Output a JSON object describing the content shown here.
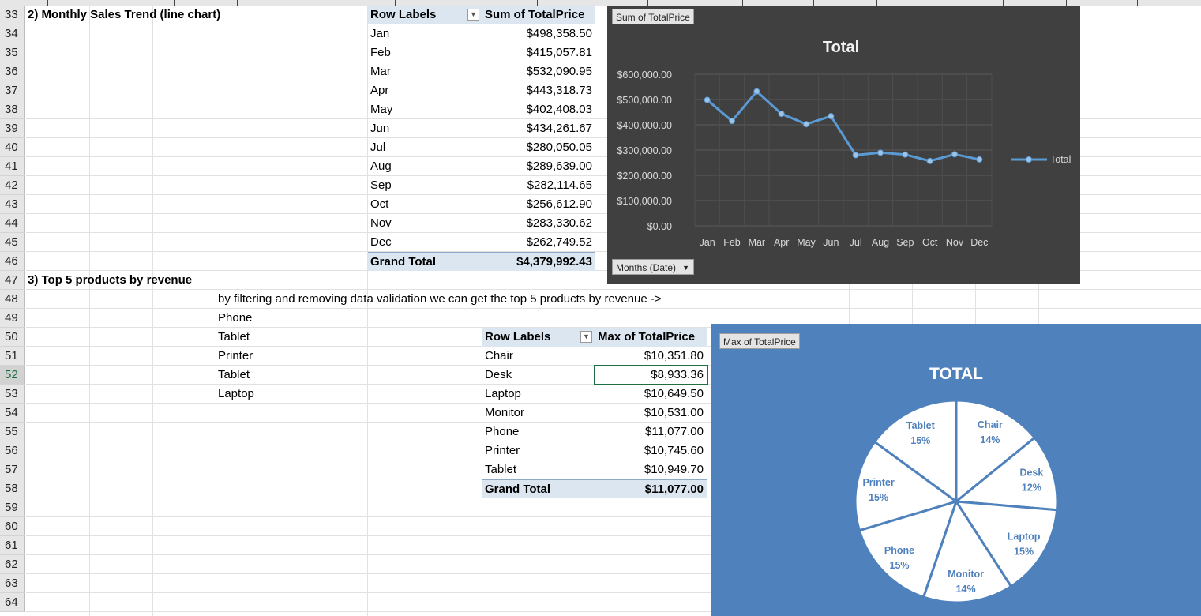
{
  "sheet": {
    "rows": [
      "33",
      "34",
      "35",
      "36",
      "37",
      "38",
      "39",
      "40",
      "41",
      "42",
      "43",
      "44",
      "45",
      "46",
      "47",
      "48",
      "49",
      "50",
      "51",
      "52",
      "53",
      "54",
      "55",
      "56",
      "57",
      "58",
      "59",
      "60",
      "61",
      "62",
      "63",
      "64"
    ],
    "selected_row": "52",
    "section2_title": "2) Monthly Sales Trend (line chart)",
    "section3_title": "3) Top 5 products by revenue",
    "note": "by filtering and removing data validation we can get the top 5 products by revenue ->",
    "top5_list": [
      "Phone",
      "Tablet",
      "Printer",
      "Tablet",
      "Laptop"
    ]
  },
  "pivot1": {
    "row_labels_header": "Row Labels",
    "value_header": "Sum of TotalPrice",
    "rows": [
      {
        "label": "Jan",
        "value": "$498,358.50"
      },
      {
        "label": "Feb",
        "value": "$415,057.81"
      },
      {
        "label": "Mar",
        "value": "$532,090.95"
      },
      {
        "label": "Apr",
        "value": "$443,318.73"
      },
      {
        "label": "May",
        "value": "$402,408.03"
      },
      {
        "label": "Jun",
        "value": "$434,261.67"
      },
      {
        "label": "Jul",
        "value": "$280,050.05"
      },
      {
        "label": "Aug",
        "value": "$289,639.00"
      },
      {
        "label": "Sep",
        "value": "$282,114.65"
      },
      {
        "label": "Oct",
        "value": "$256,612.90"
      },
      {
        "label": "Nov",
        "value": "$283,330.62"
      },
      {
        "label": "Dec",
        "value": "$262,749.52"
      }
    ],
    "grand_total_label": "Grand Total",
    "grand_total_value": "$4,379,992.43"
  },
  "pivot2": {
    "row_labels_header": "Row Labels",
    "value_header": "Max of TotalPrice",
    "rows": [
      {
        "label": "Chair",
        "value": "$10,351.80"
      },
      {
        "label": "Desk",
        "value": "$8,933.36"
      },
      {
        "label": "Laptop",
        "value": "$10,649.50"
      },
      {
        "label": "Monitor",
        "value": "$10,531.00"
      },
      {
        "label": "Phone",
        "value": "$11,077.00"
      },
      {
        "label": "Printer",
        "value": "$10,745.60"
      },
      {
        "label": "Tablet",
        "value": "$10,949.70"
      }
    ],
    "grand_total_label": "Grand Total",
    "grand_total_value": "$11,077.00"
  },
  "line_chart": {
    "field_button": "Sum of TotalPrice",
    "axis_button": "Months (Date)",
    "legend_label": "Total",
    "background": "#404040",
    "line_color": "#5b9bd5"
  },
  "pie_chart": {
    "field_button": "Max of TotalPrice",
    "background": "#4f81bd"
  },
  "chart_data": [
    {
      "type": "line",
      "title": "Total",
      "categories": [
        "Jan",
        "Feb",
        "Mar",
        "Apr",
        "May",
        "Jun",
        "Jul",
        "Aug",
        "Sep",
        "Oct",
        "Nov",
        "Dec"
      ],
      "series": [
        {
          "name": "Total",
          "values": [
            498358.5,
            415057.81,
            532090.95,
            443318.73,
            402408.03,
            434261.67,
            280050.05,
            289639.0,
            282114.65,
            256612.9,
            283330.62,
            262749.52
          ]
        }
      ],
      "ylim": [
        0,
        600000
      ],
      "ytick_labels": [
        "$600,000.00",
        "$500,000.00",
        "$400,000.00",
        "$300,000.00",
        "$200,000.00",
        "$100,000.00",
        "$0.00"
      ],
      "grid": true,
      "legend": "right"
    },
    {
      "type": "pie",
      "title": "TOTAL",
      "categories": [
        "Chair",
        "Desk",
        "Laptop",
        "Monitor",
        "Phone",
        "Printer",
        "Tablet"
      ],
      "values": [
        10351.8,
        8933.36,
        10649.5,
        10531.0,
        11077.0,
        10745.6,
        10949.7
      ],
      "labels": [
        "14%",
        "12%",
        "15%",
        "14%",
        "15%",
        "15%",
        "15%"
      ]
    }
  ]
}
